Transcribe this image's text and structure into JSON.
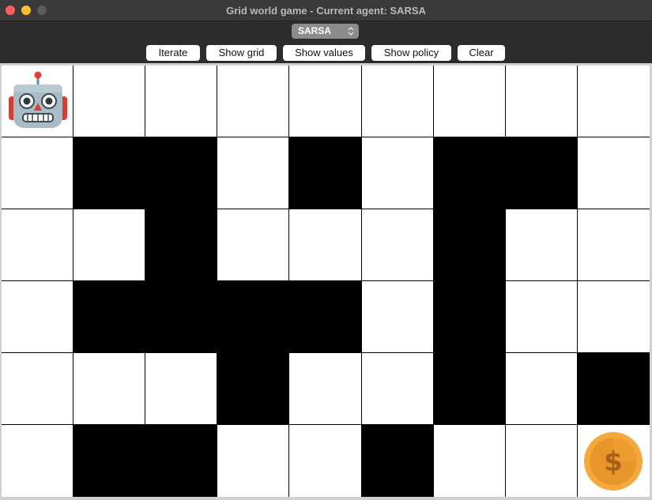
{
  "window": {
    "title": "Grid world game - Current agent: SARSA"
  },
  "toolbar": {
    "agent_select_value": "SARSA",
    "buttons": {
      "iterate": "Iterate",
      "show_grid": "Show grid",
      "show_values": "Show values",
      "show_policy": "Show policy",
      "clear": "Clear"
    }
  },
  "grid": {
    "rows": 6,
    "cols": 9,
    "cells": [
      [
        "agent",
        "empty",
        "empty",
        "empty",
        "empty",
        "empty",
        "empty",
        "empty",
        "empty"
      ],
      [
        "empty",
        "wall",
        "wall",
        "empty",
        "wall",
        "empty",
        "wall",
        "wall",
        "empty"
      ],
      [
        "empty",
        "empty",
        "wall",
        "empty",
        "empty",
        "empty",
        "wall",
        "empty",
        "empty"
      ],
      [
        "empty",
        "wall",
        "wall",
        "wall",
        "wall",
        "empty",
        "wall",
        "empty",
        "empty"
      ],
      [
        "empty",
        "empty",
        "empty",
        "wall",
        "empty",
        "empty",
        "wall",
        "empty",
        "wall"
      ],
      [
        "empty",
        "wall",
        "wall",
        "empty",
        "empty",
        "wall",
        "empty",
        "empty",
        "goal"
      ]
    ],
    "agent_icon": "robot-icon",
    "goal_icon": "coin-icon",
    "colors": {
      "wall": "#000000",
      "empty": "#ffffff",
      "grid_line": "#000000",
      "coin": "#f4a93a"
    }
  }
}
